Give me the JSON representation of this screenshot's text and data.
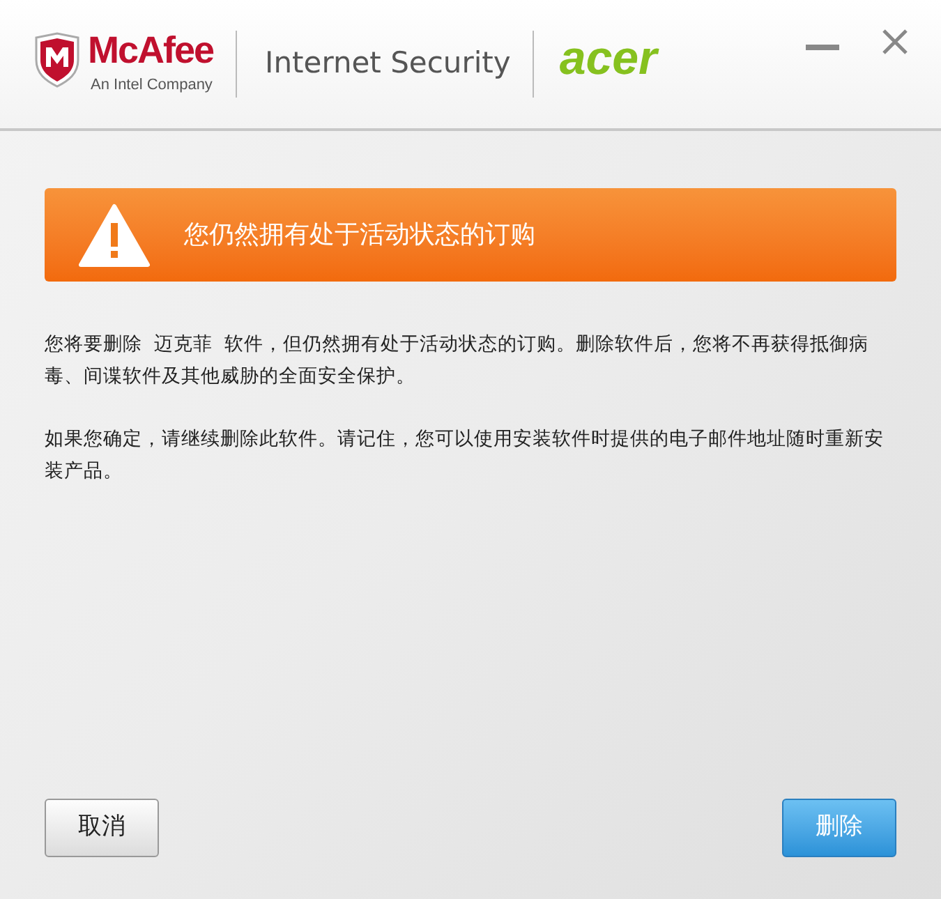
{
  "header": {
    "brand": "McAfee",
    "brand_tagline": "An Intel Company",
    "product": "Internet Security",
    "partner": "acer"
  },
  "alert": {
    "title": "您仍然拥有处于活动状态的订购"
  },
  "paragraphs": [
    "您将要删除  迈克菲  软件，但仍然拥有处于活动状态的订购。删除软件后，您将不再获得抵御病毒、间谍软件及其他威胁的全面安全保护。",
    "如果您确定，请继续删除此软件。请记住，您可以使用安装软件时提供的电子邮件地址随时重新安装产品。"
  ],
  "buttons": [
    {
      "label": "取消",
      "kind": "secondary"
    },
    {
      "label": "删除",
      "kind": "primary"
    }
  ]
}
